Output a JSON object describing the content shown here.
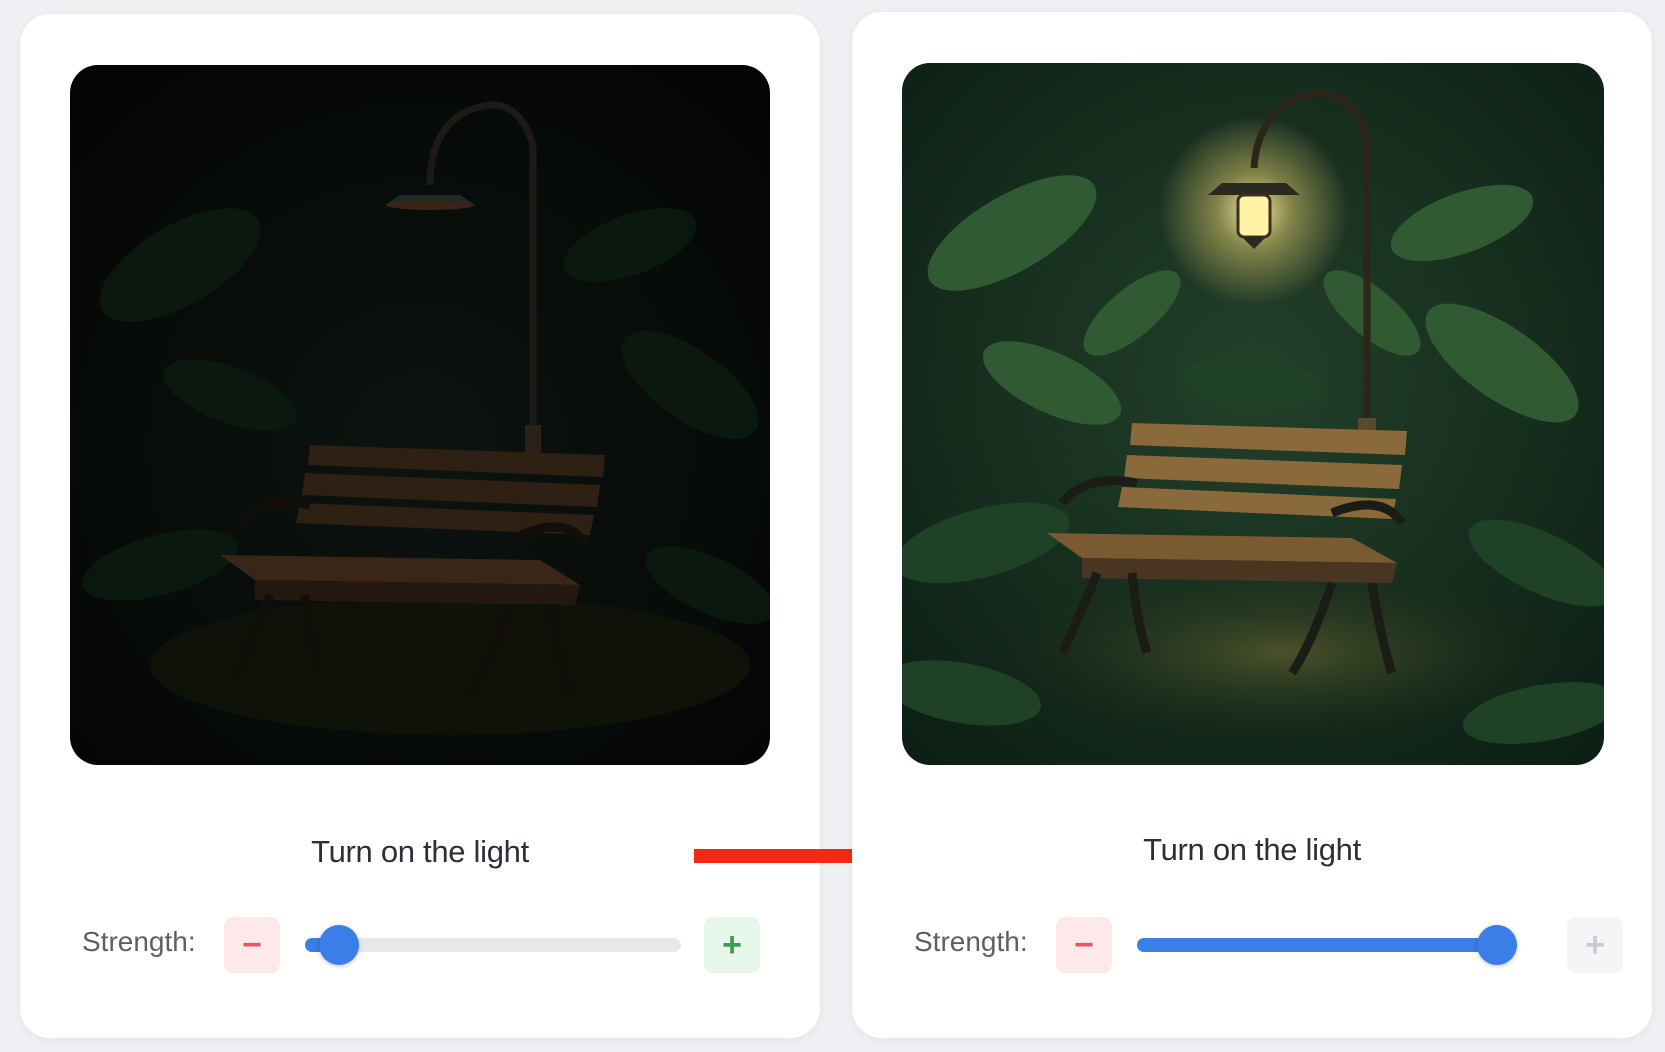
{
  "panels": [
    {
      "id": "before",
      "scene": "Dark jungle at night with an unlit street lamp over a wooden park bench",
      "title": "Turn on the light",
      "strength_label": "Strength:",
      "minus_label": "−",
      "plus_label": "+",
      "strength_value": 0.09,
      "plus_enabled": true
    },
    {
      "id": "after",
      "scene": "Jungle at night with a glowing street lamp illuminating a wooden park bench",
      "title": "Turn on the light",
      "strength_label": "Strength:",
      "minus_label": "−",
      "plus_label": "+",
      "strength_value": 1.0,
      "plus_enabled": false
    }
  ],
  "colors": {
    "accent": "#3b7ee8",
    "arrow": "#f22a14",
    "minus": "#e05a62",
    "plus": "#3d9c52"
  },
  "icons": {
    "arrow": "arrow-right-icon"
  }
}
